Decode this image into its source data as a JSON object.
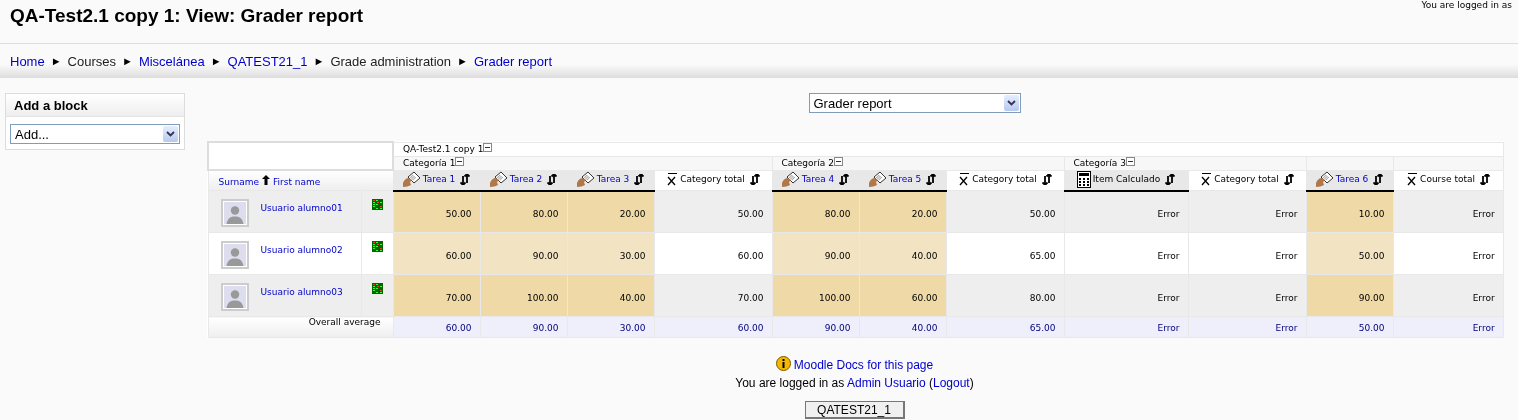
{
  "header": {
    "title": "QA-Test2.1 copy 1: View: Grader report",
    "login_text": "You are logged in as"
  },
  "breadcrumb": [
    {
      "label": "Home",
      "link": true,
      "separator": "►"
    },
    {
      "label": "Courses",
      "link": false,
      "separator": "►"
    },
    {
      "label": "Miscelánea",
      "link": true,
      "separator": "►"
    },
    {
      "label": "QATEST21_1",
      "link": true,
      "separator": "►"
    },
    {
      "label": "Grade administration",
      "link": false,
      "separator": "►"
    },
    {
      "label": "Grader report",
      "link": true
    }
  ],
  "block": {
    "title": "Add a block",
    "select": "Add..."
  },
  "report_select": "Grader report",
  "grader": {
    "course": "QA-Test2.1 copy 1",
    "groups": [
      {
        "name": "Categoría 1",
        "columns": [
          {
            "kind": "item",
            "label": "Tarea 1"
          },
          {
            "kind": "item",
            "label": "Tarea 2"
          },
          {
            "kind": "item",
            "label": "Tarea 3"
          },
          {
            "kind": "total",
            "label": "Category total"
          }
        ]
      },
      {
        "name": "Categoría 2",
        "columns": [
          {
            "kind": "item",
            "label": "Tarea 4"
          },
          {
            "kind": "item",
            "label": "Tarea 5"
          },
          {
            "kind": "total",
            "label": "Category total"
          }
        ]
      },
      {
        "name": "Categoría 3",
        "columns": [
          {
            "kind": "calc",
            "label": "Item Calculado"
          },
          {
            "kind": "total",
            "label": "Category total"
          }
        ]
      },
      {
        "columns": [
          {
            "kind": "item",
            "label": "Tarea 6"
          }
        ]
      },
      {
        "columns": [
          {
            "kind": "total",
            "label": "Course total"
          }
        ]
      }
    ],
    "sort": {
      "surname": "Surname",
      "first_name": "First name"
    },
    "students": [
      {
        "name": "Usuario alumno01",
        "grades": [
          "50.00",
          "80.00",
          "20.00",
          "50.00",
          "80.00",
          "20.00",
          "50.00",
          "Error",
          "Error",
          "10.00",
          "Error"
        ]
      },
      {
        "name": "Usuario alumno02",
        "grades": [
          "60.00",
          "90.00",
          "30.00",
          "60.00",
          "90.00",
          "40.00",
          "65.00",
          "Error",
          "Error",
          "50.00",
          "Error"
        ]
      },
      {
        "name": "Usuario alumno03",
        "grades": [
          "70.00",
          "100.00",
          "40.00",
          "70.00",
          "100.00",
          "60.00",
          "80.00",
          "Error",
          "Error",
          "90.00",
          "Error"
        ]
      }
    ],
    "average": {
      "label": "Overall average",
      "values": [
        "60.00",
        "90.00",
        "30.00",
        "60.00",
        "90.00",
        "40.00",
        "65.00",
        "Error",
        "Error",
        "50.00",
        "Error"
      ]
    }
  },
  "footer": {
    "docs_link": "Moodle Docs for this page",
    "login": [
      {
        "text": "You are logged in as "
      },
      {
        "link": "Admin Usuario"
      },
      {
        "text": " ("
      },
      {
        "link": "Logout"
      },
      {
        "text": ")"
      }
    ],
    "button": "QATEST21_1"
  }
}
